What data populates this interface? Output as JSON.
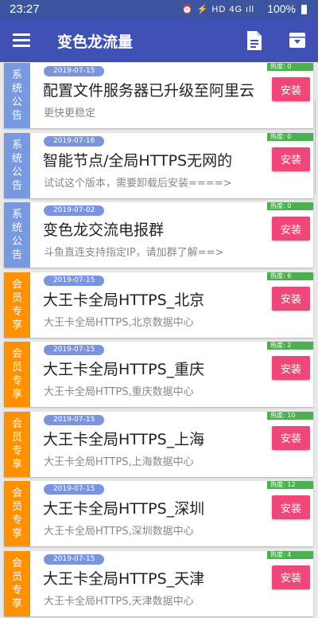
{
  "status_bar": {
    "time": "23:27",
    "icons": "⏰ ⚡ HD 4G ıll",
    "battery": "100%"
  },
  "app_bar": {
    "title": "变色龙流量",
    "menu_icon": "menu-icon",
    "doc_icon": "document-icon",
    "archive_icon": "archive-download-icon"
  },
  "colors": {
    "app_bar": "#3f51b5",
    "system_tag": "#7899e0",
    "member_tag": "#ff9000",
    "install_button": "#f0477a",
    "heat_badge": "#4caf50",
    "date_badge": "#7a95de"
  },
  "items": [
    {
      "tag": "系统公告",
      "tag_type": "system",
      "date": "2019-07-15",
      "title": "配置文件服务器已升级至阿里云",
      "subtitle": "更快更稳定",
      "heat": "热度: 0",
      "button": "安装"
    },
    {
      "tag": "系统公告",
      "tag_type": "system",
      "date": "2019-07-16",
      "title": "智能节点/全局HTTPS无网的",
      "subtitle": "试试这个版本，需要卸载后安装====>",
      "heat": "热度: 0",
      "button": "安装"
    },
    {
      "tag": "系统公告",
      "tag_type": "system",
      "date": "2019-07-02",
      "title": "变色龙交流电报群",
      "subtitle": "斗鱼直连支持指定IP，请加群了解==>",
      "heat": "热度: 0",
      "button": "安装"
    },
    {
      "tag": "会员专享",
      "tag_type": "member",
      "date": "2019-07-15",
      "title": "大王卡全局HTTPS_北京",
      "subtitle": "大王卡全局HTTPS,北京数据中心",
      "heat": "热度: 6",
      "button": "安装"
    },
    {
      "tag": "会员专享",
      "tag_type": "member",
      "date": "2019-07-15",
      "title": "大王卡全局HTTPS_重庆",
      "subtitle": "大王卡全局HTTPS,重庆数据中心",
      "heat": "热度: 2",
      "button": "安装"
    },
    {
      "tag": "会员专享",
      "tag_type": "member",
      "date": "2019-07-15",
      "title": "大王卡全局HTTPS_上海",
      "subtitle": "大王卡全局HTTPS,上海数据中心",
      "heat": "热度: 10",
      "button": "安装"
    },
    {
      "tag": "会员专享",
      "tag_type": "member",
      "date": "2019-07-15",
      "title": "大王卡全局HTTPS_深圳",
      "subtitle": "大王卡全局HTTPS,深圳数据中心",
      "heat": "热度: 12",
      "button": "安装"
    },
    {
      "tag": "会员专享",
      "tag_type": "member",
      "date": "2019-07-15",
      "title": "大王卡全局HTTPS_天津",
      "subtitle": "大王卡全局HTTPS,天津数据中心",
      "heat": "热度: 4",
      "button": "安装"
    }
  ]
}
